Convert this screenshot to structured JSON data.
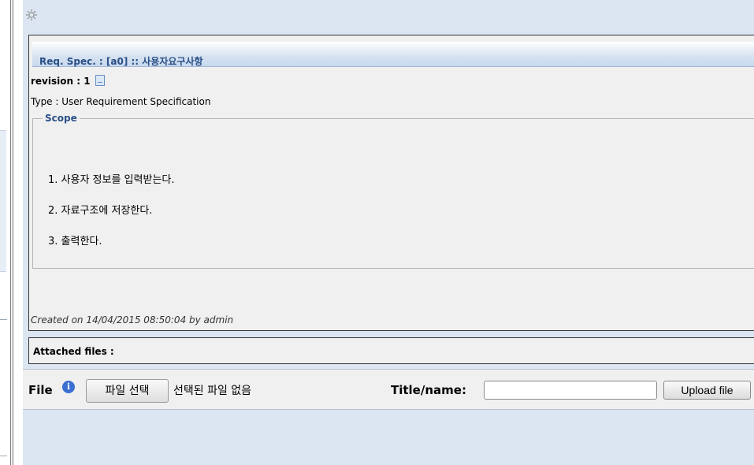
{
  "spec": {
    "title": "Req. Spec. : [a0] :: 사용자요구사항",
    "revision_label": "revision : 1",
    "type_text": "Type : User Requirement Specification",
    "scope_legend": "Scope",
    "scope_items": [
      "1. 사용자 정보를 입력받는다.",
      "2. 자료구조에 저장한다.",
      "3. 출력한다."
    ],
    "created_text": "Created on 14/04/2015 08:50:04  by admin"
  },
  "attachments": {
    "header": "Attached files :"
  },
  "upload": {
    "file_label": "File",
    "info_icon": "info-icon",
    "choose_button": "파일 선택",
    "no_file_text": "선택된 파일 없음",
    "title_label": "Title/name:",
    "title_value": "",
    "upload_button": "Upload file"
  },
  "icons": {
    "gear": "gear-icon",
    "revision": "document-icon"
  },
  "colors": {
    "panel_bg": "#dce6f2",
    "title_text": "#2a4f86",
    "info_icon": "#3b6fd1"
  }
}
